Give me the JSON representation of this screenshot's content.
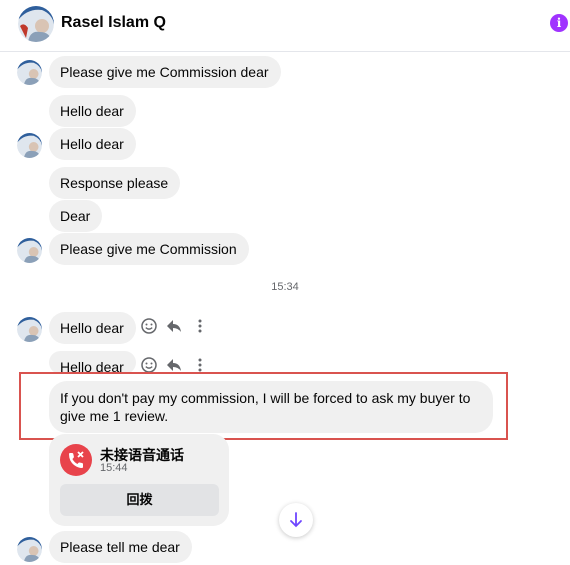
{
  "header": {
    "name": "Rasel Islam Q",
    "info_icon": "info-icon",
    "accent": "#a033ff"
  },
  "messages": [
    {
      "text": "Please give me Commission dear"
    },
    {
      "text": "Hello dear"
    },
    {
      "text": "Hello dear"
    },
    {
      "text": "Response please"
    },
    {
      "text": "Dear"
    },
    {
      "text": "Please give me Commission"
    },
    {
      "text": "Hello dear"
    },
    {
      "text": "Hello dear"
    },
    {
      "text": "If you don't pay my commission, I will be forced to ask my buyer to give me 1 review."
    },
    {
      "text": "Please tell me dear"
    }
  ],
  "timestamp": "15:34",
  "call": {
    "title": "未接语音通话",
    "time": "15:44",
    "button": "回拨",
    "color": "#e8434b"
  },
  "icons": {
    "react": "smiley-icon",
    "reply": "reply-icon",
    "more": "more-dots-icon",
    "scroll": "arrow-down-icon"
  },
  "colors": {
    "bubble": "#f0f0f0",
    "highlight": "#d9534f",
    "scroll_arrow": "#6e46ff"
  }
}
